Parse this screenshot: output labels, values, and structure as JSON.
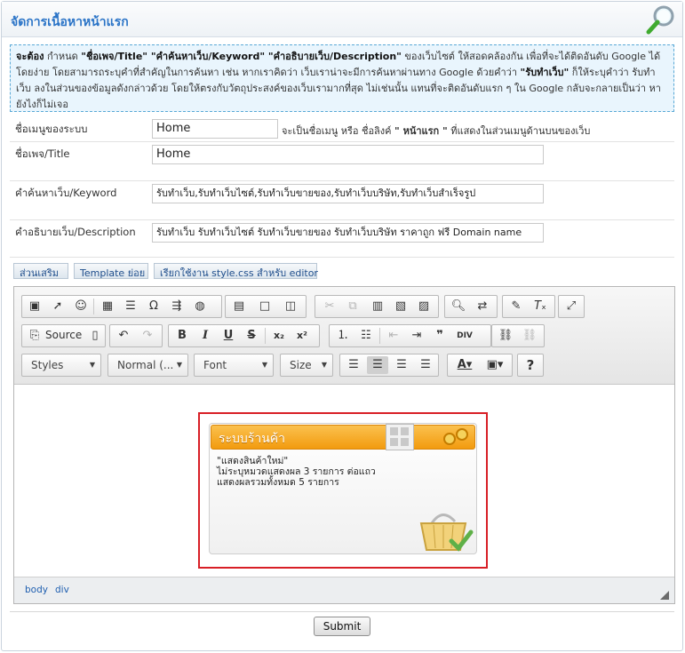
{
  "panel": {
    "title": "จัดการเนื้อหาหน้าแรก",
    "search_icon": "magnifier-icon"
  },
  "info": {
    "lead": "จะต้อง",
    "t1": " กำหนด ",
    "b1": "\"ชื่อเพจ/Title\" \"คำค้นหาเว็บ/Keyword\" \"คำอธิบายเว็บ/Description\"",
    "t2": " ของเว็บไซต์ ให้สอดคล้องกัน เพื่อที่จะได้ติดอันดับ Google ได้โดยง่าย โดยสามารถระบุคำที่สำคัญในการค้นหา เช่น หากเราคิดว่า เว็บเราน่าจะมีการค้นหาผ่านทาง Google ด้วยคำว่า ",
    "b2": "\"รับทำเว็บ\"",
    "t3": " ก็ให้ระบุคำว่า รับทำเว็บ ลงในส่วนของข้อมูลดังกล่าวด้วย โดยให้ตรงกับวัตถุประสงค์ของเว็บเรามากที่สุด ไม่เช่นนั้น แทนที่จะติดอันดับแรก ๆ ใน Google กลับจะกลายเป็นว่า หายังไงก็ไม่เจอ"
  },
  "fields": {
    "menu_name": {
      "label": "ชื่อเมนูของระบบ",
      "value": "Home",
      "note_a": "จะเป็นชื่อเมนู หรือ ชื่อลิงค์ ",
      "note_b": "\" หน้าแรก \"",
      "note_c": " ที่แสดงในส่วนเมนูด้านบนของเว็บ"
    },
    "title": {
      "label": "ชื่อเพจ/Title",
      "value": "Home"
    },
    "keyword": {
      "label": "คำค้นหาเว็บ/Keyword",
      "value": "รับทำเว็บ,รับทำเว็บไซต์,รับทำเว็บขายของ,รับทำเว็บบริษัท,รับทำเว็บสำเร็จรูป"
    },
    "description": {
      "label": "คำอธิบายเว็บ/Description",
      "value": "รับทำเว็บ รับทำเว็บไซต์ รับทำเว็บขายของ รับทำเว็บบริษัท ราคาถูก ฟรี Domain name"
    }
  },
  "tabs": [
    "ส่วนเสริม",
    "Template ย่อย",
    "เรียกใช้งาน style.css สำหรับ editor"
  ],
  "toolbar": {
    "source_label": "Source",
    "styles": "Styles",
    "format": "Normal (...",
    "font": "Font",
    "size": "Size"
  },
  "widget": {
    "title": "ระบบร้านค้า",
    "line1": "\"แสดงสินค้าใหม่\"",
    "line2": "ไม่ระบุหมวดแสดงผล 3 รายการ ต่อแถว",
    "line3": "แสดงผลรวมทั้งหมด 5 รายการ"
  },
  "path": [
    "body",
    "div"
  ],
  "submit_label": "Submit"
}
